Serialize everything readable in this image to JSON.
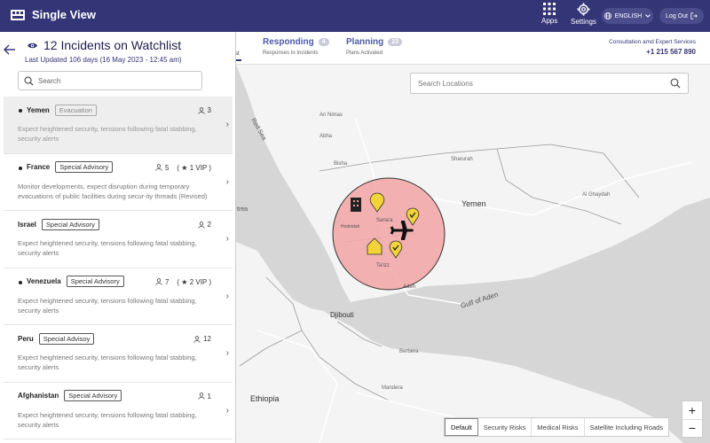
{
  "topbar": {
    "title": "Single View",
    "apps_label": "Apps",
    "settings_label": "Settings",
    "language": "ENGLISH",
    "logout_label": "Log Out"
  },
  "tabs": [
    {
      "label": "Responding",
      "count": "4",
      "sub": "Responses to Incidents"
    },
    {
      "label": "Planning",
      "count": "23",
      "sub": "Plans Activated"
    }
  ],
  "tab_fragment": "st",
  "consult": {
    "label": "Consultation amd Expert Services",
    "phone": "+1 215 567 890"
  },
  "panel": {
    "title": "12 Incidents on Watchlist",
    "updated": "Last Updated 106 days (16 May 2023 - 12:45 am)",
    "search_placeholder": "Search"
  },
  "incidents": [
    {
      "country": "Yemen",
      "tag": "Evacuation",
      "count": "3",
      "vip": "",
      "dot": true,
      "desc": "Expect heightened security, tensions following fatal stabbing, security alerts"
    },
    {
      "country": "France",
      "tag": "Special Advisory",
      "count": "5",
      "vip": "( ★ 1 VIP )",
      "dot": true,
      "desc": "Monitor developments, expect disruption during temporary evacuations of public facilities during secur-ity threads (Revised)"
    },
    {
      "country": "Israel",
      "tag": "Special Advisory",
      "count": "2",
      "vip": "",
      "dot": false,
      "desc": "Expect heightened security, tensions following fatal stabbing, security alerts"
    },
    {
      "country": "Venezuela",
      "tag": "Special Advisory",
      "count": "7",
      "vip": "( ★ 2 VIP )",
      "dot": true,
      "desc": "Expect heightened security, tensions following fatal stabbing, security alerts"
    },
    {
      "country": "Peru",
      "tag": "Special Advisoy",
      "count": "12",
      "vip": "",
      "dot": false,
      "desc": "Expect heightened security, tensions following fatal stabbing, security alerts"
    },
    {
      "country": "Afghanistan",
      "tag": "Special Advisory",
      "count": "1",
      "vip": "",
      "dot": false,
      "desc": "Expect heightened security, tensions following fatal stabbing, security alerts"
    }
  ],
  "map": {
    "search_placeholder": "Search Locations",
    "labels": {
      "red_sea": "Red Sea",
      "yemen": "Yemen",
      "gulf": "Gulf of Aden",
      "djibouti": "Djibouti",
      "ethiopia": "Ethiopia",
      "an_nimas": "An Nimas",
      "abha": "Abha",
      "bisha": "Bisha",
      "sharurah": "Sharurah",
      "al_ghaydah": "Al Ghaydah",
      "sanaa": "Sana'a",
      "hodeidah": "Hodeidah",
      "taizz": "Ta'izz",
      "aden": "Aden",
      "eritrea": "trea",
      "berbera": "Berbera",
      "mandera": "Mandera"
    },
    "layers": [
      "Default",
      "Security Risks",
      "Medical Risks",
      "Satellite Including Roads"
    ],
    "zoom_in": "+",
    "zoom_out": "−",
    "risk_color": "#f19a9a",
    "pin_color": "#f3d33a"
  }
}
